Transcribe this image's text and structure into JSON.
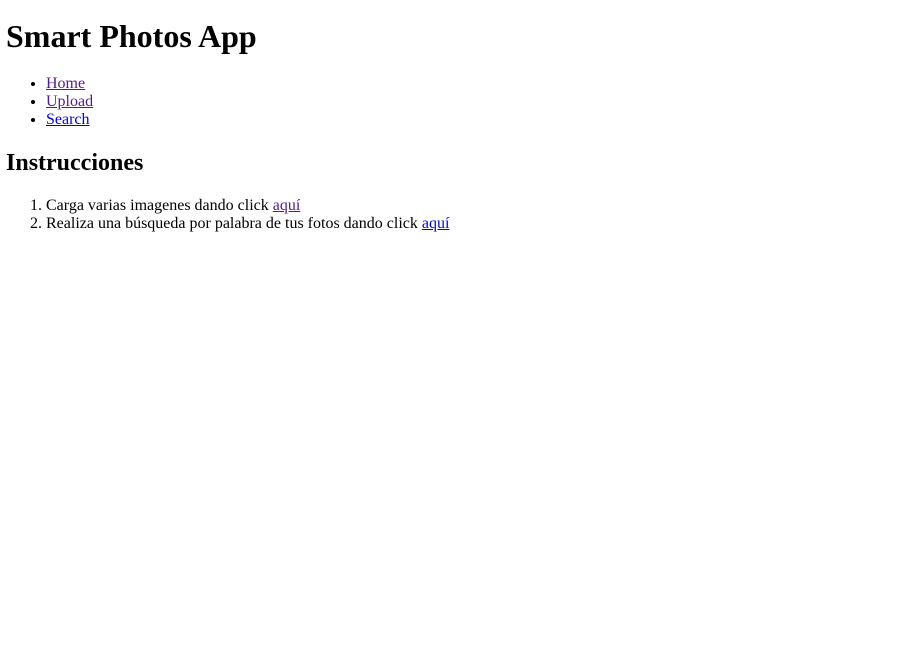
{
  "header": {
    "title": "Smart Photos App"
  },
  "nav": {
    "items": [
      {
        "label": "Home"
      },
      {
        "label": "Upload"
      },
      {
        "label": "Search"
      }
    ]
  },
  "instructions": {
    "heading": "Instrucciones",
    "steps": [
      {
        "text": "Carga varias imagenes dando click ",
        "link": "aquí"
      },
      {
        "text": "Realiza una búsqueda por palabra de tus fotos dando click ",
        "link": "aquí"
      }
    ]
  },
  "colors": {
    "visited_link": "#551a8b",
    "unvisited_link": "#0000ee",
    "text": "#000000",
    "background": "#ffffff"
  }
}
